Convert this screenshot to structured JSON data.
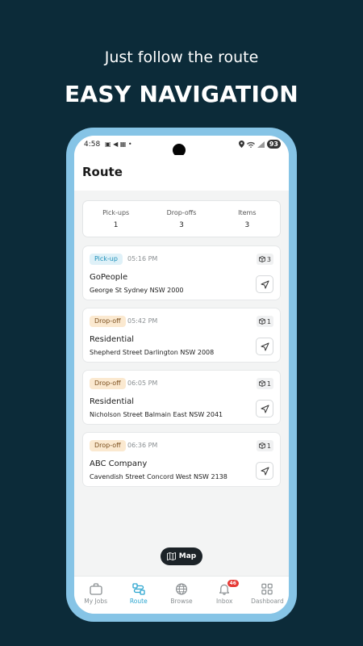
{
  "promo": {
    "subtitle": "Just follow the route",
    "title": "EASY NAVIGATION"
  },
  "status_bar": {
    "time": "4:58",
    "battery": "93"
  },
  "header": {
    "title": "Route"
  },
  "summary": [
    {
      "label": "Pick-ups",
      "value": "1"
    },
    {
      "label": "Drop-offs",
      "value": "3"
    },
    {
      "label": "Items",
      "value": "3"
    }
  ],
  "stops": [
    {
      "type": "Pick-up",
      "time": "05:16 PM",
      "name": "GoPeople",
      "address": "George St Sydney NSW 2000",
      "items": "3"
    },
    {
      "type": "Drop-off",
      "time": "05:42 PM",
      "name": "Residential",
      "address": "Shepherd Street Darlington NSW 2008",
      "items": "1"
    },
    {
      "type": "Drop-off",
      "time": "06:05 PM",
      "name": "Residential",
      "address": "Nicholson Street Balmain East NSW 2041",
      "items": "1"
    },
    {
      "type": "Drop-off",
      "time": "06:36 PM",
      "name": "ABC Company",
      "address": "Cavendish Street Concord West NSW 2138",
      "items": "1"
    }
  ],
  "map_button": {
    "label": "Map",
    "icon": "map-icon"
  },
  "bottom_nav": [
    {
      "label": "My Jobs",
      "icon": "briefcase-icon",
      "active": false
    },
    {
      "label": "Route",
      "icon": "route-icon",
      "active": true
    },
    {
      "label": "Browse",
      "icon": "globe-icon",
      "active": false
    },
    {
      "label": "Inbox",
      "icon": "bell-icon",
      "active": false,
      "badge": "46"
    },
    {
      "label": "Dashboard",
      "icon": "grid-icon",
      "active": false
    }
  ],
  "colors": {
    "background": "#0c2b39",
    "phone_frame": "#86c4e6",
    "accent": "#2aa5cf",
    "pickup_badge": "#dff1f8",
    "dropoff_badge": "#fbe9d0"
  }
}
